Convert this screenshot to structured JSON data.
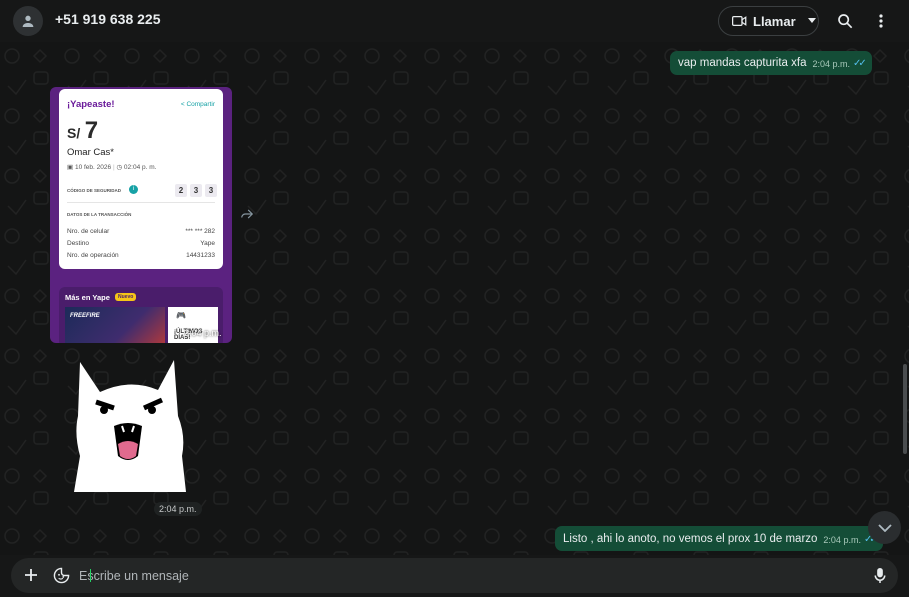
{
  "header": {
    "contact_name": "+51 919 638 225",
    "call_label": "Llamar"
  },
  "messages": {
    "out_1": {
      "text": "vap mandas capturita xfa",
      "time": "2:04 p.m."
    },
    "image": {
      "time": "2:04 p.m.",
      "receipt": {
        "title": "¡Yapeaste!",
        "share": "Compartir",
        "currency": "S/",
        "amount": "7",
        "recipient": "Omar Cas*",
        "date": "10 feb. 2026",
        "time": "02:04 p. m.",
        "security_label": "CÓDIGO DE SEGURIDAD",
        "security_digits": [
          "2",
          "3",
          "3"
        ],
        "tx_label": "DATOS DE LA TRANSACCIÓN",
        "rows": [
          {
            "label": "Nro. de celular",
            "value": "*** *** 282"
          },
          {
            "label": "Destino",
            "value": "Yape"
          },
          {
            "label": "Nro. de operación",
            "value": "14431233"
          }
        ],
        "mas_title": "Más en Yape",
        "mas_badge": "Nuevo",
        "promo_brand": "FREEFIRE",
        "promo_text": "¡ÚLTIMOS DÍAS!"
      }
    },
    "sticker": {
      "time": "2:04 p.m."
    },
    "out_2": {
      "text": "Listo , ahi lo anoto, no vemos el prox 10 de marzo",
      "time": "2:04 p.m."
    }
  },
  "composer": {
    "placeholder": "Escribe un mensaje"
  },
  "colors": {
    "background": "#161717",
    "outgoing_bubble": "#144d37",
    "read_ticks": "#53bdeb",
    "yape_purple": "#6a1b9a"
  },
  "icons": [
    "person-icon",
    "video-icon",
    "chevron-down-icon",
    "search-icon",
    "more-vertical-icon",
    "forward-icon",
    "chevron-down-icon",
    "plus-icon",
    "sticker-icon",
    "mic-icon"
  ]
}
